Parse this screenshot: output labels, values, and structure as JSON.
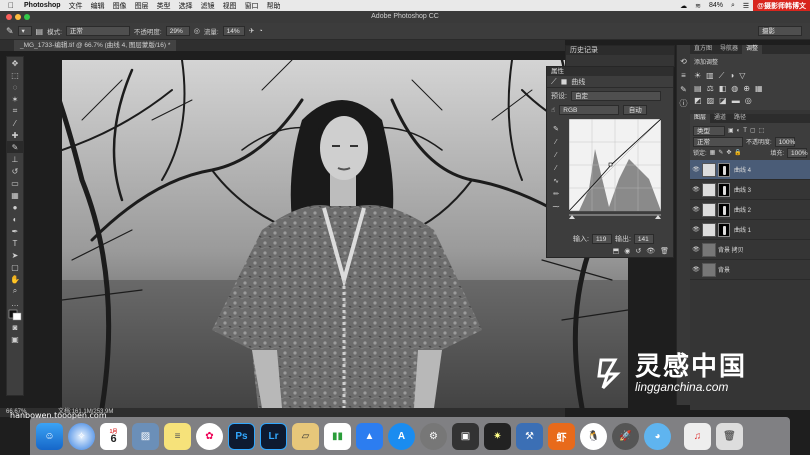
{
  "menubar": {
    "app": "Photoshop",
    "items": [
      "文件",
      "编辑",
      "图像",
      "图层",
      "类型",
      "选择",
      "滤镜",
      "视图",
      "窗口",
      "帮助"
    ],
    "battery": "84%",
    "brand": "@摄影师韩博文"
  },
  "window": {
    "title": "Adobe Photoshop CC"
  },
  "options": {
    "mode_label": "模式:",
    "mode_value": "正常",
    "opacity_label": "不透明度:",
    "opacity_value": "29%",
    "flow_label": "流量:",
    "flow_value": "14%",
    "workspace": "摄影"
  },
  "document": {
    "tab": "_MG_1733-编辑.tif @ 66.7% (曲线 4, 图层蒙版/16) *"
  },
  "status": {
    "zoom": "66.67%",
    "doc": "文档:161.1M/253.9M"
  },
  "history": {
    "title": "历史记录"
  },
  "properties": {
    "title": "属性",
    "subtitle": "曲线",
    "preset_label": "预设:",
    "preset_value": "自定",
    "channel": "RGB",
    "auto": "自动",
    "input_label": "输入:",
    "input_value": "119",
    "output_label": "输出:",
    "output_value": "141"
  },
  "right_top": {
    "tabs": [
      "直方图",
      "导航器",
      "调整"
    ],
    "adjust_title": "添加调整"
  },
  "layers": {
    "tabs": [
      "图层",
      "通道",
      "路径"
    ],
    "kind": "类型",
    "blend": "正常",
    "opacity_label": "不透明度:",
    "opacity_value": "100%",
    "lock_label": "锁定:",
    "fill_label": "填充:",
    "fill_value": "100%",
    "items": [
      {
        "name": "曲线 4"
      },
      {
        "name": "曲线 3"
      },
      {
        "name": "曲线 2"
      },
      {
        "name": "曲线 1"
      },
      {
        "name": "背景 拷贝"
      },
      {
        "name": "背景"
      }
    ]
  },
  "watermark": {
    "left": "hanbowen.tooopen.com",
    "brand_cn": "灵感中国",
    "brand_url": "lingganchina.com"
  },
  "dock": [
    "Finder",
    "Safari",
    "Calendar",
    "Preview",
    "Notes",
    "Photos",
    "Ps",
    "Lr",
    "Keynote",
    "Numbers",
    "App Store",
    "System Preferences",
    "Photo Booth",
    "Final Cut",
    "Xcode",
    "虾",
    "QQ",
    "Launchpad",
    "Twitterrific",
    "iTunes",
    "Trash"
  ],
  "calendar": {
    "month": "1月",
    "day": "6"
  }
}
